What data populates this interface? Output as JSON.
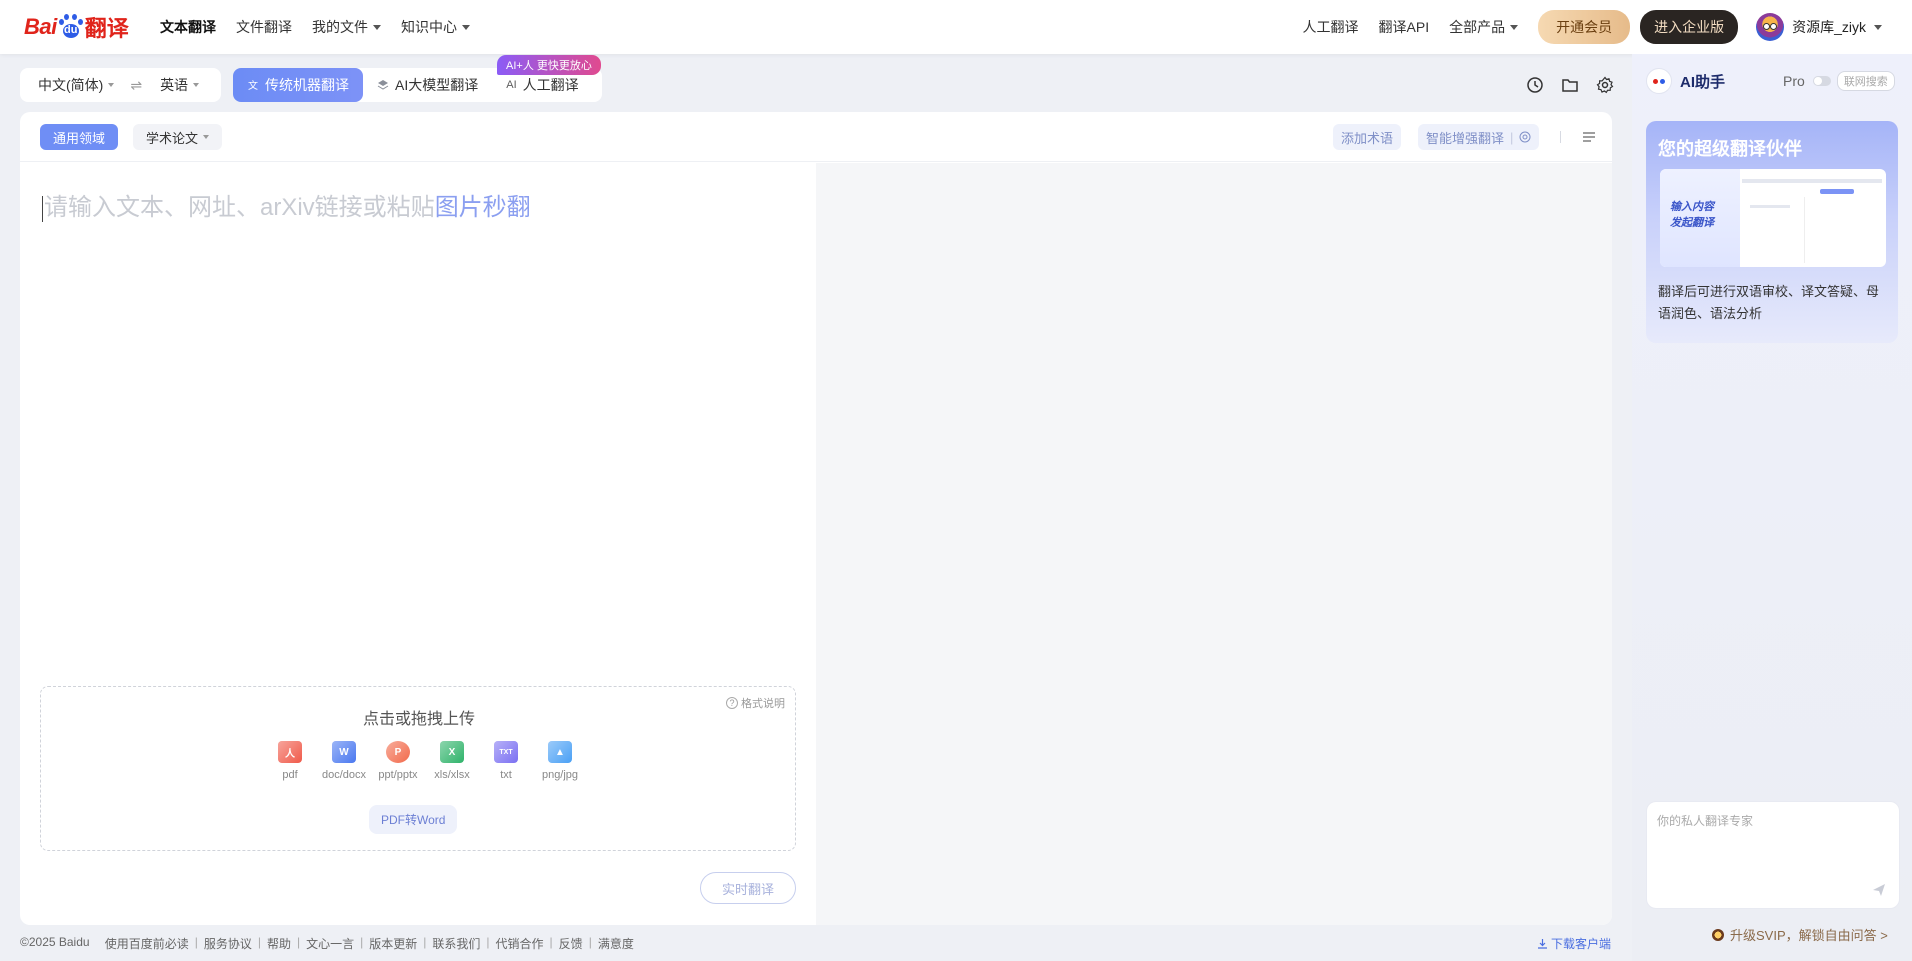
{
  "logo": {
    "bai": "Bai",
    "du": "du",
    "fanyi": "翻译"
  },
  "nav": {
    "items": [
      {
        "label": "文本翻译",
        "active": true,
        "dropdown": false
      },
      {
        "label": "文件翻译",
        "active": false,
        "dropdown": false
      },
      {
        "label": "我的文件",
        "active": false,
        "dropdown": true
      },
      {
        "label": "知识中心",
        "active": false,
        "dropdown": true
      }
    ]
  },
  "header_right": {
    "human_translation": "人工翻译",
    "api": "翻译API",
    "all_products": "全部产品",
    "vip": "开通会员",
    "enterprise": "进入企业版",
    "username": "资源库_ziyk"
  },
  "language": {
    "source": "中文(简体)",
    "swap_icon": "⇌",
    "target": "英语"
  },
  "modes": {
    "machine": "传统机器翻译",
    "llm": "AI大模型翻译",
    "human": "人工翻译",
    "human_prefix": "AI",
    "badge": "AI+人 更快更放心"
  },
  "editor": {
    "domain": "通用领域",
    "paper": "学术论文",
    "add_term": "添加术语",
    "enhanced": "智能增强翻译",
    "placeholder_main": "请输入文本、网址、arXiv链接或粘贴",
    "placeholder_highlight": "图片秒翻",
    "upload_title": "点击或拖拽上传",
    "format_help": "格式说明",
    "file_types": [
      {
        "label": "pdf",
        "color": "#f05a4a",
        "glyph": "人"
      },
      {
        "label": "doc/docx",
        "color": "#4a78f0",
        "glyph": "W"
      },
      {
        "label": "ppt/pptx",
        "color": "#f26a4b",
        "glyph": "P"
      },
      {
        "label": "xls/xlsx",
        "color": "#2fb36a",
        "glyph": "X"
      },
      {
        "label": "txt",
        "color": "#7b70f2",
        "glyph": "TXT"
      },
      {
        "label": "png/jpg",
        "color": "#4aa0f5",
        "glyph": "▲"
      }
    ],
    "pdf_word": "PDF转Word",
    "realtime": "实时翻译"
  },
  "footer": {
    "links": [
      "©2025 Baidu",
      "使用百度前必读",
      "服务协议",
      "帮助",
      "文心一言",
      "版本更新",
      "联系我们",
      "代销合作",
      "反馈",
      "满意度"
    ],
    "download": "下载客户端"
  },
  "assistant": {
    "title": "AI助手",
    "pro": "Pro",
    "net_search": "联网搜索",
    "promo_title": "您的超级翻译伙伴",
    "promo_shot_text": "输入内容\n发起翻译",
    "promo_desc": "翻译后可进行双语审校、译文答疑、母语润色、语法分析",
    "input_placeholder": "你的私人翻译专家",
    "upgrade": "升级SVIP，解锁自由问答 >"
  },
  "colors": {
    "accent": "#6f8ef5",
    "brand_red": "#e0241b",
    "brand_blue": "#2e5ce6"
  }
}
